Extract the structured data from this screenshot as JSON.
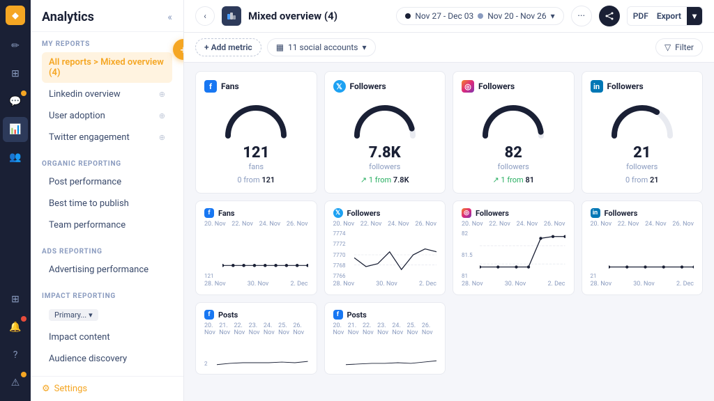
{
  "app": {
    "title": "Analytics",
    "collapseLabel": "«"
  },
  "sidebar": {
    "my_reports_label": "MY REPORTS",
    "active_item": "All reports > Mixed overview (4)",
    "items": [
      {
        "id": "linkedin-overview",
        "label": "Linkedin overview",
        "pinned": true
      },
      {
        "id": "user-adoption",
        "label": "User adoption",
        "pinned": true
      },
      {
        "id": "twitter-engagement",
        "label": "Twitter engagement",
        "pinned": true
      }
    ],
    "organic_label": "ORGANIC REPORTING",
    "organic_items": [
      {
        "id": "post-performance",
        "label": "Post performance"
      },
      {
        "id": "best-time",
        "label": "Best time to publish"
      },
      {
        "id": "team-performance",
        "label": "Team performance"
      }
    ],
    "ads_label": "ADS REPORTING",
    "ads_items": [
      {
        "id": "advertising",
        "label": "Advertising performance"
      }
    ],
    "impact_label": "IMPACT REPORTING",
    "impact_badge": "Primary...",
    "impact_items": [
      {
        "id": "impact-content",
        "label": "Impact content"
      },
      {
        "id": "audience-discovery",
        "label": "Audience discovery"
      }
    ],
    "settings_label": "Settings"
  },
  "topbar": {
    "report_title": "Mixed overview (4)",
    "date_range_1": "Nov 27 - Dec 03",
    "date_range_2": "Nov 20 - Nov 26",
    "dot1_color": "#1a2035",
    "dot2_color": "#8a9bbf",
    "export_label": "PDF",
    "export_text": "Export"
  },
  "toolbar": {
    "add_metric_label": "+ Add metric",
    "accounts_label": "11 social accounts",
    "filter_label": "Filter"
  },
  "cards_row1": [
    {
      "platform": "fb",
      "platform_label": "f",
      "metric_label": "Fans",
      "value": "121",
      "unit": "fans",
      "change": "0 from",
      "change_value": "121",
      "trend": "none"
    },
    {
      "platform": "tw",
      "platform_label": "t",
      "metric_label": "Followers",
      "value": "7.8K",
      "unit": "followers",
      "change": "↗ 1 from",
      "change_value": "7.8K",
      "trend": "up"
    },
    {
      "platform": "ig",
      "platform_label": "◎",
      "metric_label": "Followers",
      "value": "82",
      "unit": "followers",
      "change": "↗ 1 from",
      "change_value": "81",
      "trend": "up"
    },
    {
      "platform": "li",
      "platform_label": "in",
      "metric_label": "Followers",
      "value": "21",
      "unit": "followers",
      "change": "0 from",
      "change_value": "21",
      "trend": "none"
    }
  ],
  "cards_row2": [
    {
      "platform": "fb",
      "platform_label": "f",
      "metric_label": "Fans",
      "dates_top": [
        "20. Nov",
        "22. Nov",
        "24. Nov",
        "26. Nov"
      ],
      "y_values": [
        "",
        "121"
      ],
      "dates_bottom": [
        "28. Nov",
        "30. Nov",
        "2. Dec"
      ],
      "flat_value": "121",
      "chart_type": "flat"
    },
    {
      "platform": "tw",
      "platform_label": "t",
      "metric_label": "Followers",
      "dates_top": [
        "20. Nov",
        "22. Nov",
        "24. Nov",
        "26. Nov"
      ],
      "y_values": [
        "7774",
        "7772",
        "7770",
        "7768",
        "7766"
      ],
      "dates_bottom": [
        "28. Nov",
        "30. Nov",
        "2. Dec"
      ],
      "chart_type": "wave"
    },
    {
      "platform": "ig",
      "platform_label": "◎",
      "metric_label": "Followers",
      "dates_top": [
        "20. Nov",
        "22. Nov",
        "24. Nov",
        "26. Nov"
      ],
      "y_values": [
        "82",
        "81.5",
        "81"
      ],
      "dates_bottom": [
        "28. Nov",
        "30. Nov",
        "2. Dec"
      ],
      "chart_type": "spike"
    },
    {
      "platform": "li",
      "platform_label": "in",
      "metric_label": "Followers",
      "dates_top": [
        "20. Nov",
        "22. Nov",
        "24. Nov",
        "26. Nov"
      ],
      "y_values": [
        "21"
      ],
      "dates_bottom": [
        "28. Nov",
        "30. Nov",
        "2. Dec"
      ],
      "flat_value": "21",
      "chart_type": "flat"
    }
  ],
  "cards_row3": [
    {
      "platform": "fb",
      "platform_label": "f",
      "metric_label": "Posts",
      "dates_top": [
        "20. Nov",
        "21. Nov",
        "22. Nov",
        "23. Nov",
        "24. Nov",
        "25. Nov",
        "26. Nov"
      ],
      "y_start": "2",
      "chart_type": "bar-small"
    },
    {
      "platform": "fb",
      "platform_label": "f",
      "metric_label": "Posts",
      "dates_top": [
        "20. Nov",
        "21. Nov",
        "22. Nov",
        "23. Nov",
        "24. Nov",
        "25. Nov",
        "26. Nov"
      ],
      "chart_type": "bar-small"
    }
  ],
  "nav_icons": [
    {
      "id": "logo",
      "symbol": "◆",
      "type": "logo"
    },
    {
      "id": "compose",
      "symbol": "✏",
      "active": false
    },
    {
      "id": "publish",
      "symbol": "▦",
      "active": false
    },
    {
      "id": "engage",
      "symbol": "💬",
      "active": false,
      "badge": "orange"
    },
    {
      "id": "reports",
      "symbol": "📊",
      "active": true
    },
    {
      "id": "users",
      "symbol": "👥",
      "active": false
    },
    {
      "id": "box",
      "symbol": "⊞",
      "active": false
    },
    {
      "id": "bell",
      "symbol": "🔔",
      "active": false,
      "badge": "red"
    },
    {
      "id": "help",
      "symbol": "?",
      "active": false
    },
    {
      "id": "warning",
      "symbol": "⚠",
      "active": false,
      "badge": "orange"
    }
  ]
}
